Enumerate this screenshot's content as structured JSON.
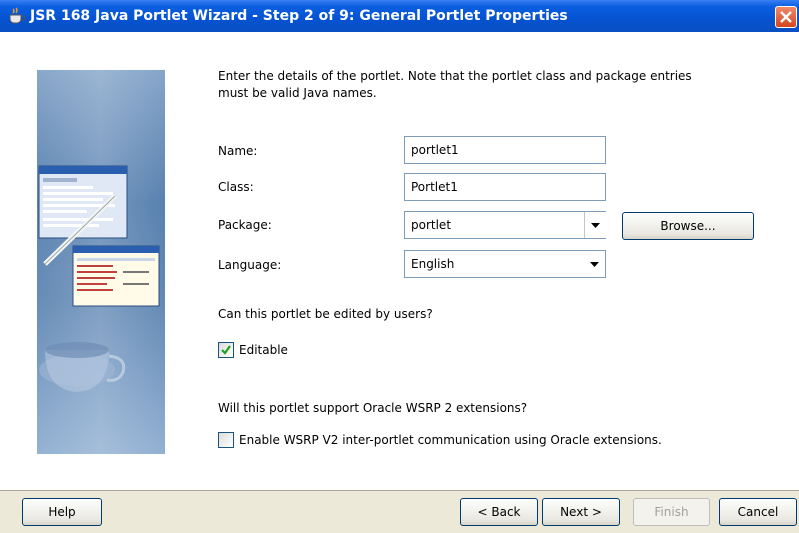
{
  "window": {
    "title": "JSR 168 Java Portlet Wizard - Step 2 of 9: General Portlet Properties"
  },
  "intro": "Enter the details of the portlet. Note that the portlet class and package entries must be valid Java names.",
  "fields": {
    "name_label": "Name:",
    "name_value": "portlet1",
    "class_label": "Class:",
    "class_value": "Portlet1",
    "package_label": "Package:",
    "package_value": "portlet",
    "language_label": "Language:",
    "language_value": "English",
    "browse_label": "Browse..."
  },
  "edit_section": {
    "question": "Can this portlet be edited by users?",
    "checkbox_label": "Editable",
    "checked": true
  },
  "wsrp_section": {
    "question": "Will this portlet support Oracle WSRP 2 extensions?",
    "checkbox_label": "Enable WSRP V2 inter-portlet communication using Oracle extensions.",
    "checked": false
  },
  "footer": {
    "help": "Help",
    "back": "< Back",
    "next": "Next >",
    "finish": "Finish",
    "cancel": "Cancel"
  },
  "colors": {
    "titlebar": "#0652d1",
    "dialog_bg": "#ece9d8",
    "checkmark": "#21a121"
  },
  "icons": {
    "title": "coffee-cup-icon",
    "close": "close-icon",
    "dropdown": "chevron-down-icon",
    "check": "checkmark-icon"
  }
}
